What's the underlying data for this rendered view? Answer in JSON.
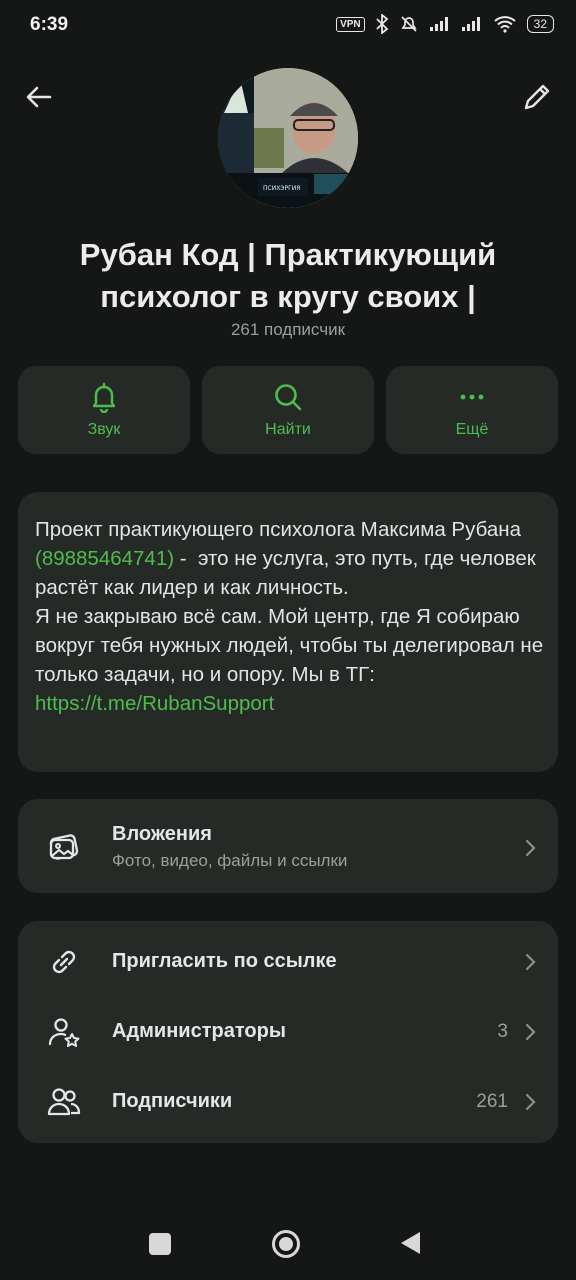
{
  "status_bar": {
    "time": "6:39",
    "vpn": "VPN",
    "battery": "32"
  },
  "header": {
    "back_icon": "arrow-left-icon",
    "edit_icon": "pencil-icon",
    "channel_title": "Рубан Код | Практикующий психолог в кругу своих |",
    "subscribers": "261 подписчик",
    "avatar_logo_text": "ПСИХЭРГИЯ"
  },
  "actions": [
    {
      "label": "Звук",
      "icon": "bell-icon"
    },
    {
      "label": "Найти",
      "icon": "search-icon"
    },
    {
      "label": "Ещё",
      "icon": "more-dots-icon"
    }
  ],
  "about": {
    "text_before_phone": "Проект практикующего психолога Максима Рубана ",
    "phone": "(89885464741)",
    "text_middle": " -  это не услуга, это путь, где человек растёт как лидер и как личность.\nЯ не закрываю всё сам. Мой центр, где Я собираю вокруг тебя нужных людей, чтобы ты делегировал не только задачи, но и опору. Мы в ТГ: ",
    "link": "https://t.me/RubanSupport"
  },
  "attachments": {
    "title": "Вложения",
    "subtitle": "Фото, видео, файлы и ссылки",
    "icon": "media-gallery-icon"
  },
  "menu": [
    {
      "label": "Пригласить по ссылке",
      "count": "",
      "icon": "link-icon"
    },
    {
      "label": "Администраторы",
      "count": "3",
      "icon": "admin-star-icon"
    },
    {
      "label": "Подписчики",
      "count": "261",
      "icon": "people-icon"
    }
  ],
  "colors": {
    "accent": "#4ebd4e",
    "background": "#151716",
    "card": "#262a27"
  }
}
